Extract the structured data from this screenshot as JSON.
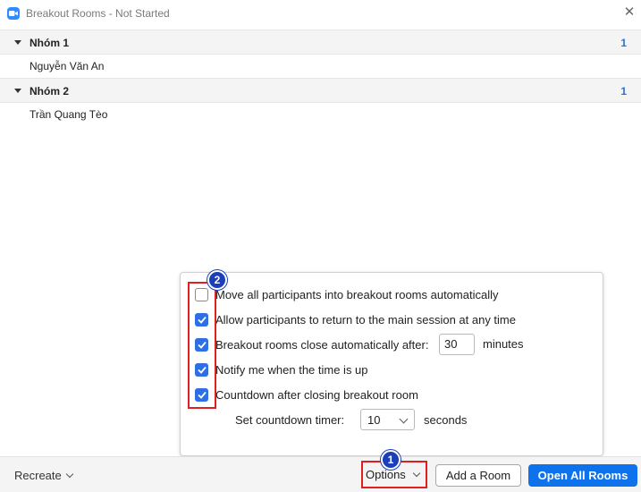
{
  "window": {
    "title": "Breakout Rooms - Not Started",
    "close_symbol": "✕"
  },
  "rooms": [
    {
      "name": "Nhóm 1",
      "count": "1",
      "participants": [
        "Nguyễn Văn An"
      ]
    },
    {
      "name": "Nhóm 2",
      "count": "1",
      "participants": [
        "Trần Quang Tèo"
      ]
    }
  ],
  "options_popup": {
    "items": [
      {
        "label": "Move all participants into breakout rooms automatically",
        "checked": false
      },
      {
        "label": "Allow participants to return to the main session at any time",
        "checked": true
      },
      {
        "label": "Breakout rooms close automatically after:",
        "checked": true
      },
      {
        "label": "Notify me when the time is up",
        "checked": true
      },
      {
        "label": "Countdown after closing breakout room",
        "checked": true
      }
    ],
    "close_after_value": "30",
    "close_after_unit": "minutes",
    "countdown_label": "Set countdown timer:",
    "countdown_value": "10",
    "countdown_unit": "seconds"
  },
  "footer": {
    "recreate_label": "Recreate",
    "options_label": "Options",
    "add_room_label": "Add a Room",
    "open_all_label": "Open All Rooms"
  },
  "annotations": {
    "badge_1": "1",
    "badge_2": "2"
  },
  "colors": {
    "accent": "#0e72ed",
    "checkbox": "#2e6fe3",
    "annotation_red": "#e02020",
    "badge_blue": "#1a3fb8"
  }
}
